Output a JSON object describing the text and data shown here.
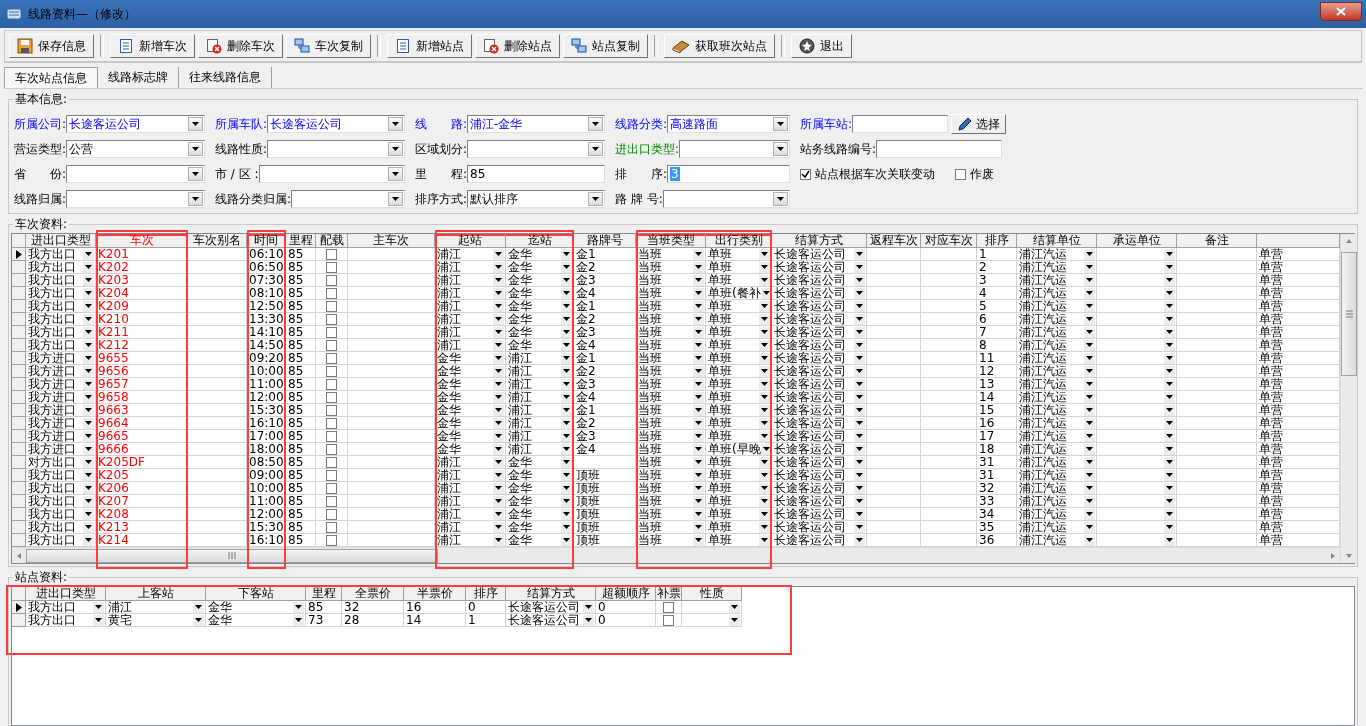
{
  "window": {
    "title": "线路资料—（修改）"
  },
  "toolbar_groups": [
    {
      "buttons": [
        {
          "kind": "save",
          "label": "保存信息"
        }
      ]
    },
    {
      "buttons": [
        {
          "kind": "new",
          "label": "新增车次"
        },
        {
          "kind": "delete",
          "label": "删除车次"
        },
        {
          "kind": "copy",
          "label": "车次复制"
        }
      ]
    },
    {
      "buttons": [
        {
          "kind": "new",
          "label": "新增站点"
        },
        {
          "kind": "delete",
          "label": "删除站点"
        },
        {
          "kind": "copy",
          "label": "站点复制"
        }
      ]
    },
    {
      "buttons": [
        {
          "kind": "fetch",
          "label": "获取班次站点"
        }
      ]
    },
    {
      "buttons": [
        {
          "kind": "exit",
          "label": "退出"
        }
      ]
    }
  ],
  "tabs": [
    {
      "label": "车次站点信息",
      "selected": true
    },
    {
      "label": "线路标志牌",
      "selected": false
    },
    {
      "label": "往来线路信息",
      "selected": false
    }
  ],
  "basic_info": {
    "title": "基本信息:",
    "rows": [
      [
        {
          "kind": "combo",
          "label": "所属公司:",
          "value": "长途客运公司",
          "required": true
        },
        {
          "kind": "combo",
          "label": "所属车队:",
          "value": "长途客运公司",
          "required": true
        },
        {
          "kind": "combo",
          "label": "线　　路:",
          "value": "浦江-金华",
          "required": true
        },
        {
          "kind": "combo",
          "label": "线路分类:",
          "value": "高速路面",
          "required": true
        },
        {
          "kind": "text",
          "label": "所属车站:",
          "required": true,
          "button": "选择"
        }
      ],
      [
        {
          "kind": "combo",
          "label": "营运类型:",
          "value": "公营"
        },
        {
          "kind": "combo",
          "label": "线路性质:"
        },
        {
          "kind": "combo",
          "label": "区域划分:"
        },
        {
          "kind": "combo",
          "label": "进出口类型:",
          "special": true
        },
        {
          "kind": "text",
          "label": "站务线路编号:"
        }
      ],
      [
        {
          "kind": "combo",
          "label": "省　　份:"
        },
        {
          "kind": "combo",
          "label": "市 / 区 :"
        },
        {
          "kind": "text",
          "label": "里　　程:",
          "value": "85"
        },
        {
          "kind": "text",
          "label": "排　　序:",
          "value": "3",
          "value_selected": true
        },
        {
          "kind": "checkboxes",
          "items": [
            {
              "label": "站点根据车次关联变动",
              "checked": true
            },
            {
              "label": "作废",
              "checked": false
            }
          ]
        }
      ],
      [
        {
          "kind": "combo",
          "label": "线路归属:"
        },
        {
          "kind": "combo",
          "label": "线路分类归属:"
        },
        {
          "kind": "combo",
          "label": "排序方式:",
          "value": "默认排序"
        },
        {
          "kind": "combo",
          "label": "路 牌 号:"
        }
      ]
    ]
  },
  "trip_grid": {
    "title": "车次资料:",
    "columns": [
      {
        "label": "进出口类型",
        "highlighted": false
      },
      {
        "label": "车次",
        "highlighted": true,
        "key": true
      },
      {
        "label": "车次别名",
        "highlighted": false
      },
      {
        "label": "时间",
        "highlighted": true
      },
      {
        "label": "里程",
        "highlighted": false
      },
      {
        "label": "配载",
        "highlighted": false
      },
      {
        "label": "主车次",
        "highlighted": false
      },
      {
        "label": "起站",
        "highlighted": true
      },
      {
        "label": "迄站",
        "highlighted": true
      },
      {
        "label": "路牌号",
        "highlighted": false
      },
      {
        "label": "当班类型",
        "highlighted": true
      },
      {
        "label": "出行类别",
        "highlighted": true
      },
      {
        "label": "结算方式",
        "highlighted": false
      },
      {
        "label": "返程车次",
        "highlighted": false
      },
      {
        "label": "对应车次",
        "highlighted": false
      },
      {
        "label": "排序",
        "highlighted": false
      },
      {
        "label": "结算单位",
        "highlighted": false
      },
      {
        "label": "承运单位",
        "highlighted": false
      },
      {
        "label": "备注",
        "highlighted": false
      }
    ],
    "rows": [
      {
        "selected": true,
        "direction": "我方出口",
        "trip": "K201",
        "time": "06:10",
        "distance": "85",
        "loaded": false,
        "from": "浦江",
        "to": "金华",
        "plate": "金1",
        "shift": "当班",
        "travel": "单班",
        "settlement": "长途客运公司",
        "order": "1",
        "unit": "浦江汽运",
        "column_20": "单营"
      },
      {
        "selected": false,
        "direction": "我方出口",
        "trip": "K202",
        "time": "06:50",
        "distance": "85",
        "loaded": false,
        "from": "浦江",
        "to": "金华",
        "plate": "金2",
        "shift": "当班",
        "travel": "单班",
        "settlement": "长途客运公司",
        "order": "2",
        "unit": "浦江汽运",
        "column_20": "单营"
      },
      {
        "selected": false,
        "direction": "我方出口",
        "trip": "K203",
        "time": "07:30",
        "distance": "85",
        "loaded": false,
        "from": "浦江",
        "to": "金华",
        "plate": "金3",
        "shift": "当班",
        "travel": "单班",
        "settlement": "长途客运公司",
        "order": "3",
        "unit": "浦江汽运",
        "column_20": "单营"
      },
      {
        "selected": false,
        "direction": "我方出口",
        "trip": "K204",
        "time": "08:10",
        "distance": "85",
        "loaded": false,
        "from": "浦江",
        "to": "金华",
        "plate": "金4",
        "shift": "当班",
        "travel": "单班(餐补",
        "settlement": "长途客运公司",
        "order": "4",
        "unit": "浦江汽运",
        "column_20": "单营"
      },
      {
        "selected": false,
        "direction": "我方出口",
        "trip": "K209",
        "time": "12:50",
        "distance": "85",
        "loaded": false,
        "from": "浦江",
        "to": "金华",
        "plate": "金1",
        "shift": "当班",
        "travel": "单班",
        "settlement": "长途客运公司",
        "order": "5",
        "unit": "浦江汽运",
        "column_20": "单营"
      },
      {
        "selected": false,
        "direction": "我方出口",
        "trip": "K210",
        "time": "13:30",
        "distance": "85",
        "loaded": false,
        "from": "浦江",
        "to": "金华",
        "plate": "金2",
        "shift": "当班",
        "travel": "单班",
        "settlement": "长途客运公司",
        "order": "6",
        "unit": "浦江汽运",
        "column_20": "单营"
      },
      {
        "selected": false,
        "direction": "我方出口",
        "trip": "K211",
        "time": "14:10",
        "distance": "85",
        "loaded": false,
        "from": "浦江",
        "to": "金华",
        "plate": "金3",
        "shift": "当班",
        "travel": "单班",
        "settlement": "长途客运公司",
        "order": "7",
        "unit": "浦江汽运",
        "column_20": "单营"
      },
      {
        "selected": false,
        "direction": "我方出口",
        "trip": "K212",
        "time": "14:50",
        "distance": "85",
        "loaded": false,
        "from": "浦江",
        "to": "金华",
        "plate": "金4",
        "shift": "当班",
        "travel": "单班",
        "settlement": "长途客运公司",
        "order": "8",
        "unit": "浦江汽运",
        "column_20": "单营"
      },
      {
        "selected": false,
        "direction": "我方进口",
        "trip": "9655",
        "time": "09:20",
        "distance": "85",
        "loaded": false,
        "from": "金华",
        "to": "浦江",
        "plate": "金1",
        "shift": "当班",
        "travel": "单班",
        "settlement": "长途客运公司",
        "order": "11",
        "unit": "浦江汽运",
        "column_20": "单营"
      },
      {
        "selected": false,
        "direction": "我方进口",
        "trip": "9656",
        "time": "10:00",
        "distance": "85",
        "loaded": false,
        "from": "金华",
        "to": "浦江",
        "plate": "金2",
        "shift": "当班",
        "travel": "单班",
        "settlement": "长途客运公司",
        "order": "12",
        "unit": "浦江汽运",
        "column_20": "单营"
      },
      {
        "selected": false,
        "direction": "我方进口",
        "trip": "9657",
        "time": "11:00",
        "distance": "85",
        "loaded": false,
        "from": "金华",
        "to": "浦江",
        "plate": "金3",
        "shift": "当班",
        "travel": "单班",
        "settlement": "长途客运公司",
        "order": "13",
        "unit": "浦江汽运",
        "column_20": "单营"
      },
      {
        "selected": false,
        "direction": "我方进口",
        "trip": "9658",
        "time": "12:00",
        "distance": "85",
        "loaded": false,
        "from": "金华",
        "to": "浦江",
        "plate": "金4",
        "shift": "当班",
        "travel": "单班",
        "settlement": "长途客运公司",
        "order": "14",
        "unit": "浦江汽运",
        "column_20": "单营"
      },
      {
        "selected": false,
        "direction": "我方进口",
        "trip": "9663",
        "time": "15:30",
        "distance": "85",
        "loaded": false,
        "from": "金华",
        "to": "浦江",
        "plate": "金1",
        "shift": "当班",
        "travel": "单班",
        "settlement": "长途客运公司",
        "order": "15",
        "unit": "浦江汽运",
        "column_20": "单营"
      },
      {
        "selected": false,
        "direction": "我方进口",
        "trip": "9664",
        "time": "16:10",
        "distance": "85",
        "loaded": false,
        "from": "金华",
        "to": "浦江",
        "plate": "金2",
        "shift": "当班",
        "travel": "单班",
        "settlement": "长途客运公司",
        "order": "16",
        "unit": "浦江汽运",
        "column_20": "单营"
      },
      {
        "selected": false,
        "direction": "我方进口",
        "trip": "9665",
        "time": "17:00",
        "distance": "85",
        "loaded": false,
        "from": "金华",
        "to": "浦江",
        "plate": "金3",
        "shift": "当班",
        "travel": "单班",
        "settlement": "长途客运公司",
        "order": "17",
        "unit": "浦江汽运",
        "column_20": "单营"
      },
      {
        "selected": false,
        "direction": "我方进口",
        "trip": "9666",
        "time": "18:00",
        "distance": "85",
        "loaded": false,
        "from": "金华",
        "to": "浦江",
        "plate": "金4",
        "shift": "当班",
        "travel": "单班(早晚",
        "settlement": "长途客运公司",
        "order": "18",
        "unit": "浦江汽运",
        "column_20": "单营"
      },
      {
        "selected": false,
        "direction": "对方出口",
        "trip": "K205DF",
        "time": "08:50",
        "distance": "85",
        "loaded": false,
        "from": "浦江",
        "to": "金华",
        "shift": "当班",
        "travel": "单班",
        "settlement": "长途客运公司",
        "order": "31",
        "unit": "浦江汽运",
        "column_20": "单营"
      },
      {
        "selected": false,
        "direction": "我方出口",
        "trip": "K205",
        "time": "09:00",
        "distance": "85",
        "loaded": false,
        "from": "浦江",
        "to": "金华",
        "plate": "顶班",
        "shift": "当班",
        "travel": "单班",
        "settlement": "长途客运公司",
        "order": "31",
        "unit": "浦江汽运",
        "column_20": "单营"
      },
      {
        "selected": false,
        "direction": "我方出口",
        "trip": "K206",
        "time": "10:00",
        "distance": "85",
        "loaded": false,
        "from": "浦江",
        "to": "金华",
        "plate": "顶班",
        "shift": "当班",
        "travel": "单班",
        "settlement": "长途客运公司",
        "order": "32",
        "unit": "浦江汽运",
        "column_20": "单营"
      },
      {
        "selected": false,
        "direction": "我方出口",
        "trip": "K207",
        "time": "11:00",
        "distance": "85",
        "loaded": false,
        "from": "浦江",
        "to": "金华",
        "plate": "顶班",
        "shift": "当班",
        "travel": "单班",
        "settlement": "长途客运公司",
        "order": "33",
        "unit": "浦江汽运",
        "column_20": "单营"
      },
      {
        "selected": false,
        "direction": "我方出口",
        "trip": "K208",
        "time": "12:00",
        "distance": "85",
        "loaded": false,
        "from": "浦江",
        "to": "金华",
        "plate": "顶班",
        "shift": "当班",
        "travel": "单班",
        "settlement": "长途客运公司",
        "order": "34",
        "unit": "浦江汽运",
        "column_20": "单营"
      },
      {
        "selected": false,
        "direction": "我方出口",
        "trip": "K213",
        "time": "15:30",
        "distance": "85",
        "loaded": false,
        "from": "浦江",
        "to": "金华",
        "plate": "顶班",
        "shift": "当班",
        "travel": "单班",
        "settlement": "长途客运公司",
        "order": "35",
        "unit": "浦江汽运",
        "column_20": "单营"
      },
      {
        "selected": false,
        "direction": "我方出口",
        "trip": "K214",
        "time": "16:10",
        "distance": "85",
        "loaded": false,
        "from": "浦江",
        "to": "金华",
        "plate": "顶班",
        "shift": "当班",
        "travel": "单班",
        "settlement": "长途客运公司",
        "order": "36",
        "unit": "浦江汽运",
        "column_20": "单营"
      }
    ]
  },
  "station_grid": {
    "title": "站点资料:",
    "highlighted": true,
    "columns": [
      "进出口类型",
      "上客站",
      "下客站",
      "里程",
      "全票价",
      "半票价",
      "排序",
      "结算方式",
      "超额顺序",
      "补票",
      "性质"
    ],
    "rows": [
      {
        "selected": true,
        "direction": "我方出口",
        "board": "浦江",
        "alight": "金华",
        "distance": "85",
        "full_fare": "32",
        "half_fare": "16",
        "order": "0",
        "settlement": "长途客运公司",
        "excess_order": "0",
        "supplement": false
      },
      {
        "selected": false,
        "direction": "我方出口",
        "board": "黄宅",
        "alight": "金华",
        "distance": "73",
        "full_fare": "28",
        "half_fare": "14",
        "order": "1",
        "settlement": "长途客运公司",
        "excess_order": "0",
        "supplement": false
      }
    ]
  }
}
